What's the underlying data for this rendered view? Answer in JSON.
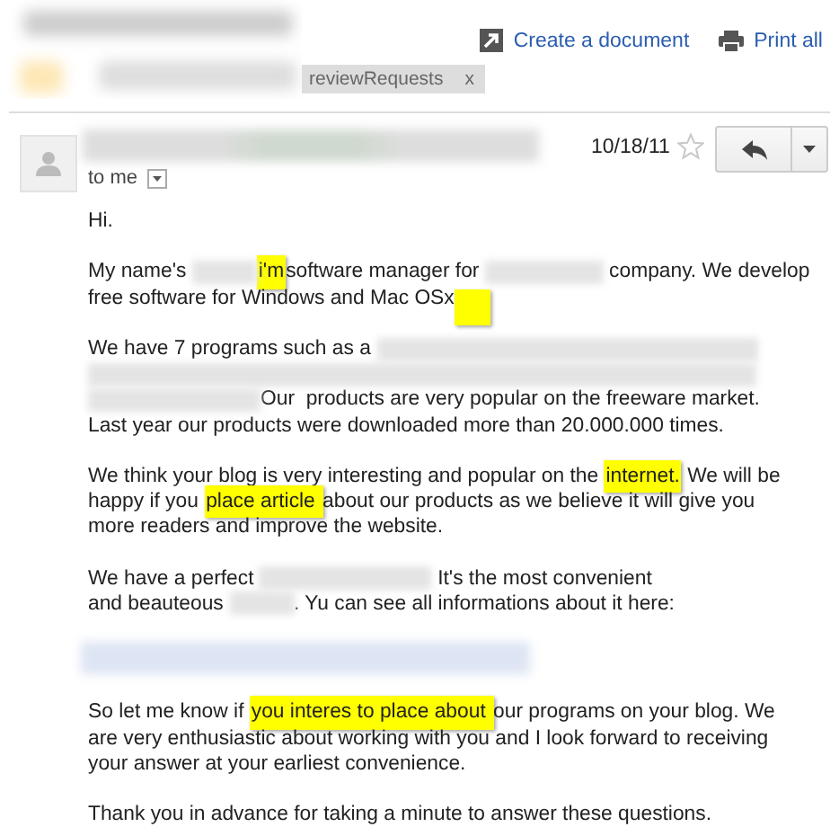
{
  "header": {
    "label": {
      "text": "reviewRequests",
      "remove": "x"
    },
    "actions": [
      {
        "kind": "document",
        "label": "Create a document"
      },
      {
        "kind": "print",
        "label": "Print all"
      }
    ]
  },
  "message": {
    "recipient": "to me",
    "date": "10/18/11",
    "starred": false
  },
  "body": [
    [
      [
        {
          "kind": "text",
          "text": "Hi."
        }
      ]
    ],
    [
      [
        {
          "kind": "text",
          "text": "My name's "
        },
        {
          "kind": "redacted_short"
        },
        {
          "kind": "highlight",
          "text": "i'm"
        },
        {
          "kind": "text",
          "text": "software manager for "
        },
        {
          "kind": "redacted_medium"
        },
        {
          "kind": "text",
          "text": " company. We develop"
        }
      ],
      [
        {
          "kind": "text",
          "text": "free software for Windows and Mac OSx"
        },
        {
          "kind": "highlight_blank"
        }
      ]
    ],
    [
      [
        {
          "kind": "text",
          "text": "We have 7 programs such as a "
        },
        {
          "kind": "redacted_long"
        }
      ],
      [
        {
          "kind": "redacted_full"
        }
      ],
      [
        {
          "kind": "redacted_wide"
        },
        {
          "kind": "text",
          "text": "Our  products are very popular on the freeware market."
        }
      ],
      [
        {
          "kind": "text",
          "text": "Last year our products were downloaded more than 20.000.000 times."
        }
      ]
    ],
    [
      [
        {
          "kind": "text",
          "text": "We think your blog is very interesting and popular on the "
        },
        {
          "kind": "highlight",
          "text": "internet."
        },
        {
          "kind": "text",
          "text": " We will be"
        }
      ],
      [
        {
          "kind": "text",
          "text": "happy if you "
        },
        {
          "kind": "highlight",
          "text": "place article "
        },
        {
          "kind": "text",
          "text": "about our products as we believe it will give you"
        }
      ],
      [
        {
          "kind": "text",
          "text": "more readers and improve the website."
        }
      ]
    ],
    [
      [
        {
          "kind": "text",
          "text": "We have a perfect "
        },
        {
          "kind": "redacted_wide"
        },
        {
          "kind": "text",
          "text": " It's the most convenient"
        }
      ],
      [
        {
          "kind": "text",
          "text": "and beauteous "
        },
        {
          "kind": "redacted_short"
        },
        {
          "kind": "text",
          "text": ". Yu can see all informations about it here:"
        }
      ]
    ],
    [
      [
        {
          "kind": "redacted_link"
        }
      ]
    ],
    [
      [
        {
          "kind": "text",
          "text": "So let me know if "
        },
        {
          "kind": "highlight",
          "text": "you interes to place about "
        },
        {
          "kind": "text",
          "text": "our programs on your blog. We"
        }
      ],
      [
        {
          "kind": "text",
          "text": "are very enthusiastic about working with you and I look forward to receiving"
        }
      ],
      [
        {
          "kind": "text",
          "text": "your answer at your earliest convenience."
        }
      ]
    ],
    [
      [
        {
          "kind": "text",
          "text": "Thank you in advance for taking a minute to answer these questions."
        }
      ]
    ]
  ]
}
